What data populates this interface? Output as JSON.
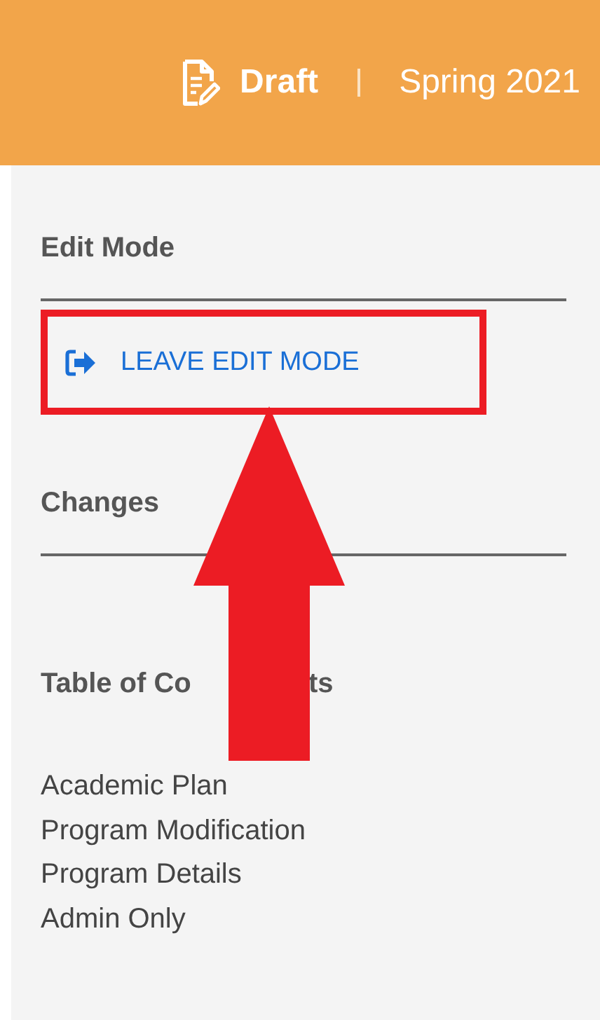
{
  "header": {
    "status": "Draft",
    "term": "Spring 2021"
  },
  "sidebar": {
    "sections": [
      {
        "kind": "actions",
        "title": "Edit Mode",
        "items": [
          {
            "label": "LEAVE EDIT MODE",
            "highlighted": true
          }
        ]
      },
      {
        "kind": "empty",
        "title": "Changes"
      },
      {
        "kind": "links",
        "title_parts": [
          "Table of Co",
          "ts"
        ],
        "items": [
          {
            "label": "Academic Plan"
          },
          {
            "label": "Program Modification"
          },
          {
            "label": "Program Details"
          },
          {
            "label": "Admin Only"
          }
        ]
      }
    ]
  },
  "annotations": [
    {
      "kind": "arrow"
    }
  ]
}
